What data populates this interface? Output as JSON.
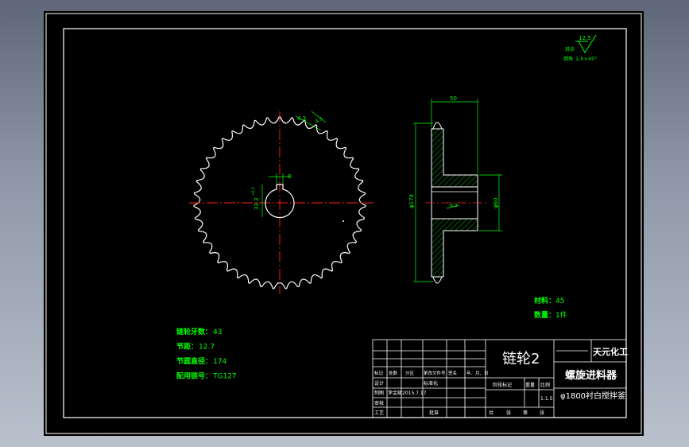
{
  "drawing": {
    "colors": {
      "background": "#000000",
      "frame": "#ffffff",
      "outline": "#ffffff",
      "centerline": "#ff2020",
      "dimension": "#00ff00",
      "text": "#00ff00",
      "title_text": "#ffffff",
      "hatch": "#00ff00"
    },
    "surface_finish": {
      "roughness": "12.5",
      "other_label": "其余",
      "chamfer_label": "倒角",
      "chamfer": "1.5×45°"
    },
    "front_view": {
      "tooth_count": 43,
      "dims": {
        "tooth_angle": "4.3",
        "keyway_width": "8",
        "keyway_depth": "33.3",
        "keyway_tol": "+0.2"
      }
    },
    "side_view": {
      "dims": {
        "hub_length": "50",
        "outer_diameter": "φ174",
        "hub_diameter": "φ60",
        "chamfer": "6.3"
      }
    },
    "notes": {
      "material_label": "材料：",
      "material": "45",
      "qty_label": "数量：",
      "qty": "1件"
    },
    "params": [
      {
        "label": "链轮牙数：",
        "value": "43"
      },
      {
        "label": "节距：",
        "value": "12.7"
      },
      {
        "label": "节圆直径：",
        "value": "174"
      },
      {
        "label": "配用链号：",
        "value": "TG127"
      }
    ],
    "title_block": {
      "part_name": "链轮2",
      "company": "天元化工",
      "assembly": "螺旋进料器",
      "subtitle": "φ1800衬白搅拌釜",
      "scale": "1:1.5",
      "header_row": [
        "标记",
        "处数",
        "分区",
        "更改文件号",
        "签名",
        "年、月、日"
      ],
      "design_label": "设计",
      "std_label": "标准化",
      "draw_label": "制图",
      "drawer": "李金斌",
      "date": "2015.7.17",
      "check_label": "审核",
      "craft_label": "工艺",
      "approve_label": "批准",
      "stage_label": "阶段标记",
      "weight_label": "重量",
      "scale_label": "比例",
      "sheet_labels": [
        "共",
        "张",
        "第",
        "张"
      ]
    }
  }
}
